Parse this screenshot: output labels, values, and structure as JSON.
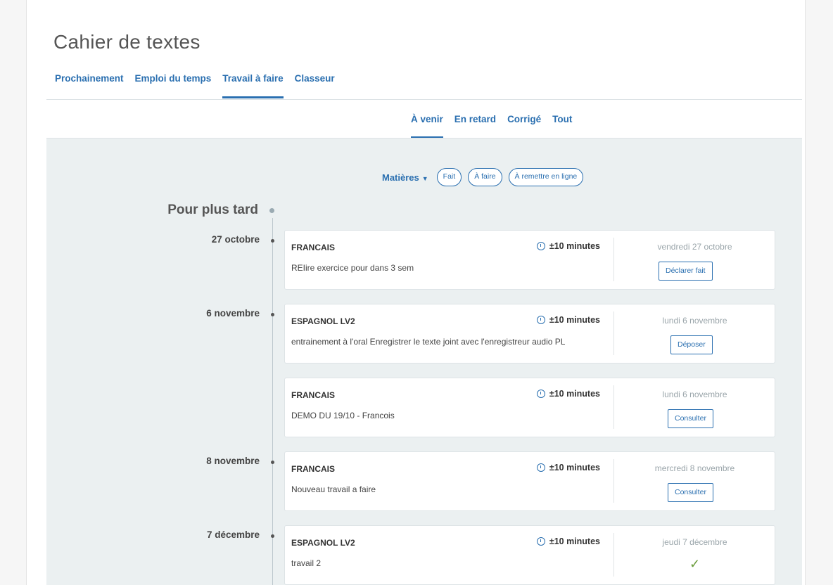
{
  "header": {
    "title": "Cahier de textes",
    "tabs": [
      {
        "label": "Prochainement",
        "active": false
      },
      {
        "label": "Emploi du temps",
        "active": false
      },
      {
        "label": "Travail à faire",
        "active": true
      },
      {
        "label": "Classeur",
        "active": false
      }
    ]
  },
  "subtabs": [
    {
      "label": "À venir",
      "active": true
    },
    {
      "label": "En retard",
      "active": false
    },
    {
      "label": "Corrigé",
      "active": false
    },
    {
      "label": "Tout",
      "active": false
    }
  ],
  "filters": {
    "dropdown": "Matières",
    "pills": [
      "Fait",
      "À faire",
      "À remettre en ligne"
    ]
  },
  "section": {
    "title": "Pour plus tard"
  },
  "duration_icon": "clock-icon",
  "groups": [
    {
      "date": "27 octobre",
      "items": [
        {
          "subject": "FRANCAIS",
          "duration": "±10 minutes",
          "description": "REIire exercice pour dans 3 sem",
          "due": "vendredi 27 octobre",
          "action": "Déclarer fait"
        }
      ]
    },
    {
      "date": "6 novembre",
      "items": [
        {
          "subject": "ESPAGNOL LV2",
          "duration": "±10 minutes",
          "description": "entrainement à l'oral Enregistrer le texte joint avec l'enregistreur audio PL",
          "due": "lundi 6 novembre",
          "action": "Déposer"
        },
        {
          "subject": "FRANCAIS",
          "duration": "±10 minutes",
          "description": "DEMO DU 19/10 - Francois",
          "due": "lundi 6 novembre",
          "action": "Consulter"
        }
      ]
    },
    {
      "date": "8 novembre",
      "items": [
        {
          "subject": "FRANCAIS",
          "duration": "±10 minutes",
          "description": "Nouveau travail a faire",
          "due": "mercredi 8 novembre",
          "action": "Consulter"
        }
      ]
    },
    {
      "date": "7 décembre",
      "items": [
        {
          "subject": "ESPAGNOL LV2",
          "duration": "±10 minutes",
          "description": "travail 2",
          "due": "jeudi 7 décembre",
          "action": "",
          "done": true,
          "done_icon": "checkmark-icon"
        }
      ]
    }
  ],
  "colors": {
    "accent": "#2a6fb0",
    "background": "#ebf0f1",
    "done": "#6a9c3b"
  }
}
